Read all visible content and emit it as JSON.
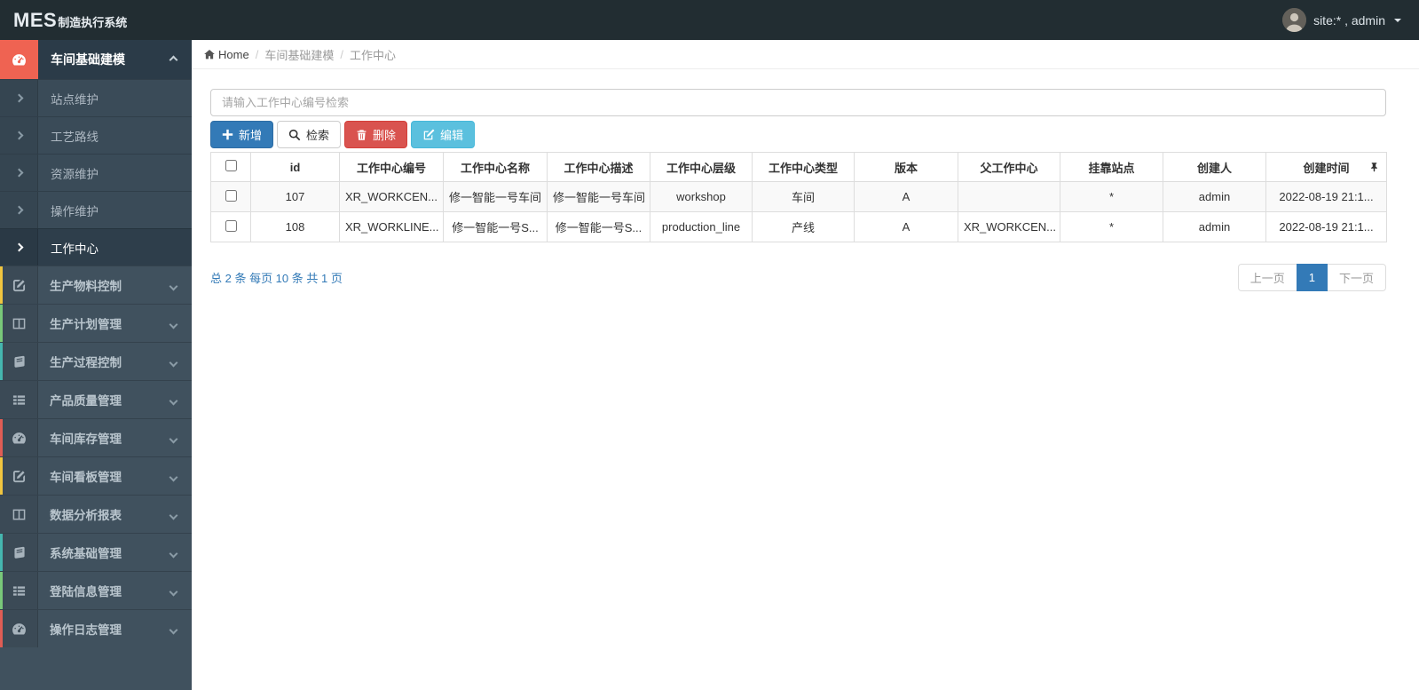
{
  "navbar": {
    "logo_bold": "MES",
    "logo_rest": "制造执行系统",
    "user_label": "site:* , admin",
    "avatar_icon": "user-avatar",
    "caret_icon": "caret-down-icon"
  },
  "breadcrumb": {
    "home_icon": "home-icon",
    "home": "Home",
    "items": [
      "车间基础建模",
      "工作中心"
    ]
  },
  "sidebar": {
    "expanded_group": {
      "key": "workshop-modeling",
      "label": "车间基础建模",
      "icon": "dashboard-icon",
      "accent_color": "#ef6352",
      "active_child": "工作中心",
      "children": [
        {
          "key": "site-maintenance",
          "label": "站点维护"
        },
        {
          "key": "process-route",
          "label": "工艺路线"
        },
        {
          "key": "resource-maintenance",
          "label": "资源维护"
        },
        {
          "key": "operation-maintenance",
          "label": "操作维护"
        },
        {
          "key": "work-center",
          "label": "工作中心"
        }
      ]
    },
    "groups": [
      {
        "key": "material-control",
        "label": "生产物料控制",
        "icon": "pencil-square-icon",
        "stripe": "#f0c53f"
      },
      {
        "key": "plan-management",
        "label": "生产计划管理",
        "icon": "columns-icon",
        "stripe": "#79c879"
      },
      {
        "key": "process-control",
        "label": "生产过程控制",
        "icon": "book-icon",
        "stripe": "#45b6af"
      },
      {
        "key": "quality-management",
        "label": "产品质量管理",
        "icon": "th-list-icon",
        "stripe": ""
      },
      {
        "key": "inventory-management",
        "label": "车间库存管理",
        "icon": "dashboard-icon",
        "stripe": "#e05d55"
      },
      {
        "key": "board-management",
        "label": "车间看板管理",
        "icon": "pencil-square-icon",
        "stripe": "#f0c53f"
      },
      {
        "key": "report-analysis",
        "label": "数据分析报表",
        "icon": "columns-icon",
        "stripe": ""
      },
      {
        "key": "system-management",
        "label": "系统基础管理",
        "icon": "book-icon",
        "stripe": "#45b6af"
      },
      {
        "key": "login-info",
        "label": "登陆信息管理",
        "icon": "th-list-icon",
        "stripe": "#79c879"
      },
      {
        "key": "operation-log",
        "label": "操作日志管理",
        "icon": "dashboard-icon",
        "stripe": "#e05d55"
      }
    ]
  },
  "search": {
    "placeholder": "请输入工作中心编号检索"
  },
  "toolbar": {
    "add_label": "新增",
    "add_icon": "plus-icon",
    "search_label": "检索",
    "search_icon": "search-icon",
    "delete_label": "删除",
    "delete_icon": "trash-icon",
    "edit_label": "编辑",
    "edit_icon": "edit-icon"
  },
  "table": {
    "pin_icon": "pin-icon",
    "columns": [
      "id",
      "工作中心编号",
      "工作中心名称",
      "工作中心描述",
      "工作中心层级",
      "工作中心类型",
      "版本",
      "父工作中心",
      "挂靠站点",
      "创建人",
      "创建时间"
    ],
    "rows": [
      [
        "107",
        "XR_WORKCEN...",
        "修一智能一号车间",
        "修一智能一号车间",
        "workshop",
        "车间",
        "A",
        "",
        "*",
        "admin",
        "2022-08-19 21:1..."
      ],
      [
        "108",
        "XR_WORKLINE...",
        "修一智能一号S...",
        "修一智能一号S...",
        "production_line",
        "产线",
        "A",
        "XR_WORKCEN...",
        "*",
        "admin",
        "2022-08-19 21:1..."
      ]
    ]
  },
  "pagination": {
    "info": "总 2 条 每页 10 条 共 1 页",
    "prev": "上一页",
    "page": "1",
    "next": "下一页"
  },
  "colors": {
    "primary": "#337ab7",
    "danger": "#d9534f",
    "info": "#5bc0de",
    "navbar_bg": "#222d32",
    "sidebar_bg": "#40515e",
    "sidebar_accent": "#ef6352",
    "stripe_yellow": "#f0c53f",
    "stripe_green": "#79c879",
    "stripe_teal": "#45b6af",
    "stripe_red": "#e05d55"
  }
}
